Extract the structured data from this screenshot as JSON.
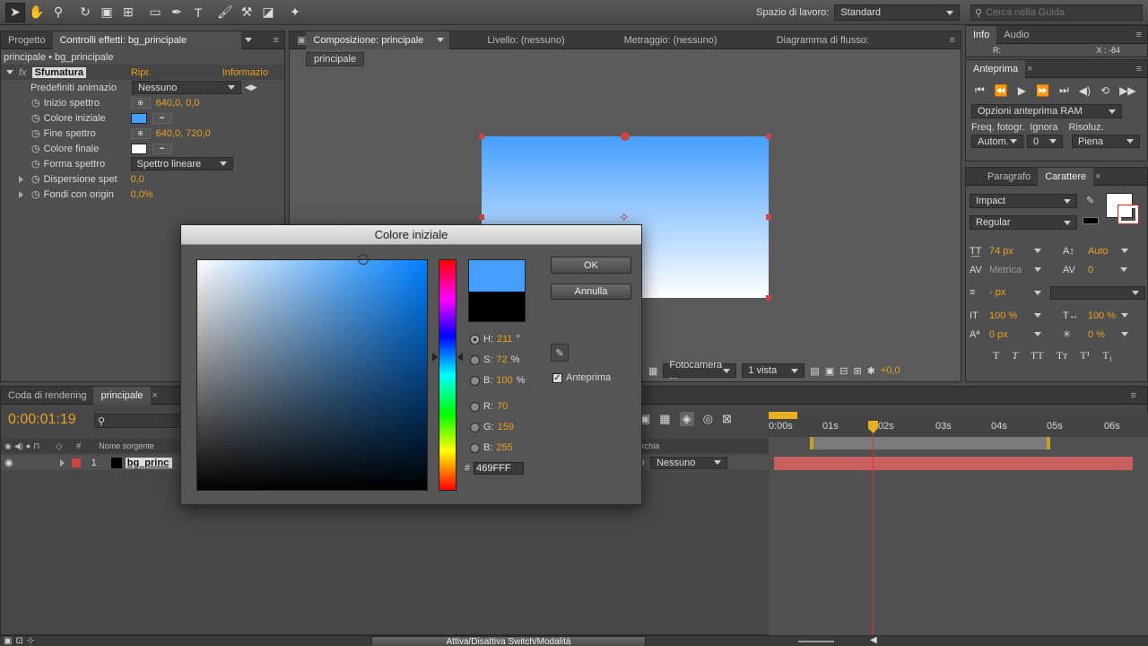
{
  "toolbar": {
    "workspace_label": "Spazio di lavoro:",
    "workspace_value": "Standard",
    "search_placeholder": "Cerca nella Guida"
  },
  "left_panel": {
    "tab_project": "Progetto",
    "tab_effects": "Controlli effetti: bg_principale",
    "breadcrumb": "principale • bg_principale",
    "effect_name": "Sfumatura",
    "effect_reset": "Ripr.",
    "effect_info": "Informazio",
    "rows": [
      {
        "label": "Predefiniti animazio",
        "value": "Nessuno"
      },
      {
        "label": "Inizio spettro",
        "value": "640,0, 0,0"
      },
      {
        "label": "Colore iniziale",
        "value": ""
      },
      {
        "label": "Fine spettro",
        "value": "640,0, 720,0"
      },
      {
        "label": "Colore finale",
        "value": ""
      },
      {
        "label": "Forma spettro",
        "value": "Spettro lineare"
      },
      {
        "label": "Dispersione spet",
        "value": "0,0"
      },
      {
        "label": "Fondi con origin",
        "value": "0,0%"
      }
    ]
  },
  "comp_panel": {
    "tab_comp": "Composizione: principale",
    "tab_layer": "Livello: (nessuno)",
    "tab_footage": "Metraggio: (nessuno)",
    "tab_flow": "Diagramma di flusso:",
    "subtab": "principale",
    "camera": "Fotocamera ...",
    "views": "1 vista",
    "exposure": "+0,0"
  },
  "info_panel": {
    "tab_info": "Info",
    "tab_audio": "Audio",
    "readout_r": "R:",
    "readout_x": "X : -84"
  },
  "preview_panel": {
    "tab": "Anteprima",
    "ram_options": "Opzioni anteprima RAM",
    "frame_rate_label": "Freq. fotogr.",
    "skip_label": "Ignora",
    "resolution_label": "Risoluz.",
    "frame_rate_value": "Autom.",
    "skip_value": "0",
    "resolution_value": "Piena"
  },
  "char_panel": {
    "tab_para": "Paragrafo",
    "tab_char": "Carattere",
    "font": "Impact",
    "style": "Regular",
    "size": "74 px",
    "leading": "Auto",
    "kerning": "Metrica",
    "tracking": "0",
    "stroke": "- px",
    "vscale": "100 %",
    "hscale": "100 %",
    "baseline": "0 px",
    "tsume": "0 %"
  },
  "timeline": {
    "tab_render": "Coda di rendering",
    "tab_comp": "principale",
    "timecode": "0:00:01:19",
    "col_num": "#",
    "col_source": "Nome sorgente",
    "col_parent": "Gerarchia",
    "layer_num": "1",
    "layer_name": "bg_princ",
    "parent_value": "Nessuno",
    "ruler": [
      "0:00s",
      "01s",
      "02s",
      "03s",
      "04s",
      "05s",
      "06s"
    ],
    "toggle_label": "Attiva/Disattiva Switch/Modalità"
  },
  "dialog": {
    "title": "Colore iniziale",
    "ok": "OK",
    "cancel": "Annulla",
    "preview_label": "Anteprima",
    "h_label": "H:",
    "h_value": "211",
    "h_unit": "°",
    "s_label": "S:",
    "s_value": "72",
    "s_unit": "%",
    "b_label": "B:",
    "b_value": "100",
    "b_unit": "%",
    "r_label": "R:",
    "r_value": "70",
    "g_label": "G:",
    "g_value": "159",
    "bl_label": "B:",
    "bl_value": "255",
    "hex_label": "#",
    "hex_value": "469FFF"
  },
  "colors": {
    "start": "#469FFF",
    "hue_base": "#0080FF",
    "end": "#FFFFFF"
  }
}
